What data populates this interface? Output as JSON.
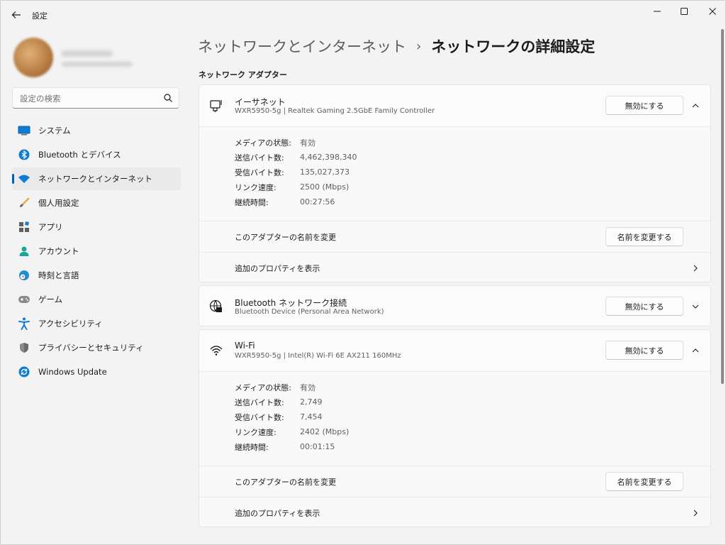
{
  "window": {
    "title": "設定",
    "controls": [
      "minimize",
      "maximize",
      "close"
    ]
  },
  "sidebar": {
    "search": {
      "value": "",
      "placeholder": "設定の検索"
    },
    "items": [
      {
        "label": "システム",
        "icon": "system-icon",
        "selected": false
      },
      {
        "label": "Bluetooth とデバイス",
        "icon": "bluetooth-icon",
        "selected": false
      },
      {
        "label": "ネットワークとインターネット",
        "icon": "wifi-icon",
        "selected": true
      },
      {
        "label": "個人用設定",
        "icon": "brush-icon",
        "selected": false
      },
      {
        "label": "アプリ",
        "icon": "apps-icon",
        "selected": false
      },
      {
        "label": "アカウント",
        "icon": "account-icon",
        "selected": false
      },
      {
        "label": "時刻と言語",
        "icon": "time-language-icon",
        "selected": false
      },
      {
        "label": "ゲーム",
        "icon": "gamepad-icon",
        "selected": false
      },
      {
        "label": "アクセシビリティ",
        "icon": "accessibility-icon",
        "selected": false
      },
      {
        "label": "プライバシーとセキュリティ",
        "icon": "shield-icon",
        "selected": false
      },
      {
        "label": "Windows Update",
        "icon": "windows-update-icon",
        "selected": false
      }
    ]
  },
  "main": {
    "breadcrumb": {
      "parent": "ネットワークとインターネット",
      "separator": "›",
      "current": "ネットワークの詳細設定"
    },
    "section_title": "ネットワーク アダプター",
    "adapters": [
      {
        "name": "イーサネット",
        "description": "WXR5950-5g | Realtek Gaming 2.5GbE Family Controller",
        "icon": "ethernet-icon",
        "button": "無効にする",
        "expanded": true,
        "details": [
          {
            "label": "メディアの状態:",
            "value": "有効"
          },
          {
            "label": "送信バイト数:",
            "value": "4,462,398,340"
          },
          {
            "label": "受信バイト数:",
            "value": "135,027,373"
          },
          {
            "label": "リンク速度:",
            "value": "2500 (Mbps)"
          },
          {
            "label": "継続時間:",
            "value": "00:27:56"
          }
        ],
        "rename_label": "このアダプターの名前を変更",
        "rename_button": "名前を変更する",
        "properties_label": "追加のプロパティを表示"
      },
      {
        "name": "Bluetooth ネットワーク接続",
        "description": "Bluetooth Device (Personal Area Network)",
        "icon": "bluetooth-network-icon",
        "button": "無効にする",
        "expanded": false
      },
      {
        "name": "Wi-Fi",
        "description": "WXR5950-5g | Intel(R) Wi-Fi 6E AX211 160MHz",
        "icon": "wifi-icon",
        "button": "無効にする",
        "expanded": true,
        "details": [
          {
            "label": "メディアの状態:",
            "value": "有効"
          },
          {
            "label": "送信バイト数:",
            "value": "2,749"
          },
          {
            "label": "受信バイト数:",
            "value": "7,454"
          },
          {
            "label": "リンク速度:",
            "value": "2402 (Mbps)"
          },
          {
            "label": "継続時間:",
            "value": "00:01:15"
          }
        ],
        "rename_label": "このアダプターの名前を変更",
        "rename_button": "名前を変更する",
        "properties_label": "追加のプロパティを表示"
      }
    ]
  },
  "colors": {
    "accent": "#005fb8",
    "background": "#f3f3f3",
    "card": "#fbfbfb"
  }
}
